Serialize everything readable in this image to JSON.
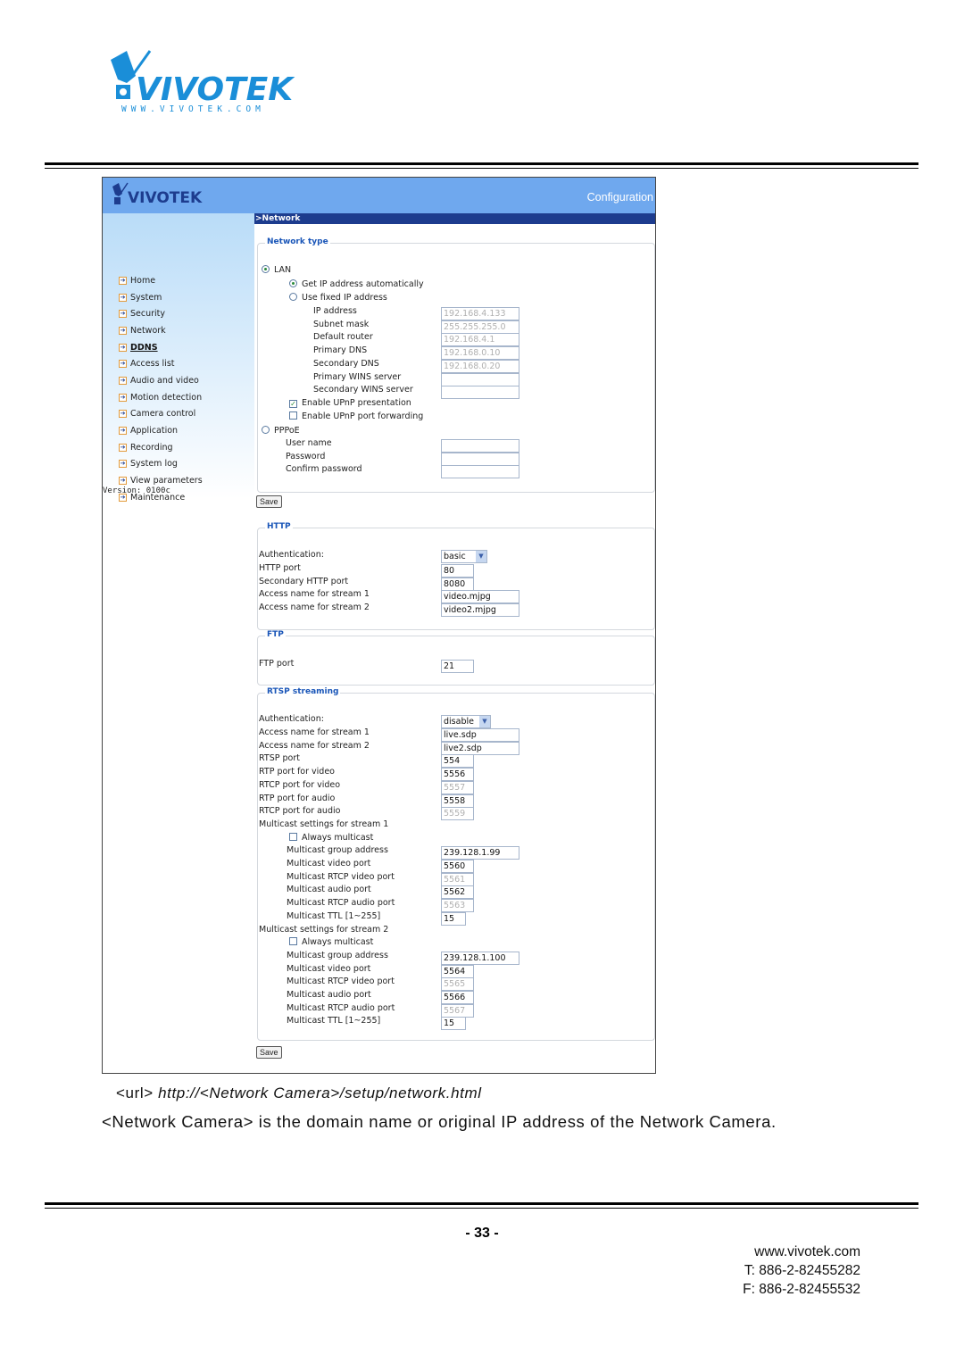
{
  "page": {
    "logo_text": "VIVOTEK",
    "logo_url_text": "WWW.VIVOTEK.COM",
    "brand_color": "#1a8ed8",
    "caption_url_prefix": "<url>",
    "caption_url": "http://<Network Camera>/setup/network.html",
    "caption_note": "<Network Camera> is the domain name or original IP address of the Network Camera.",
    "page_number": "- 33 -",
    "contact": {
      "web": "www.vivotek.com",
      "tel": "T: 886-2-82455282",
      "fax": "F: 886-2-82455532"
    }
  },
  "app": {
    "logo_text": "VIVOTEK",
    "header_title": "Configuration",
    "breadcrumb": ">Network",
    "header_color": "#6fa8ee",
    "nav_bar_color": "#1d3c8e",
    "version": "Version: 0100c",
    "sidebar": {
      "items": [
        {
          "label": "Home"
        },
        {
          "label": "System"
        },
        {
          "label": "Security"
        },
        {
          "label": "Network"
        },
        {
          "label": "DDNS",
          "active": true
        },
        {
          "label": "Access list"
        },
        {
          "label": "Audio and video"
        },
        {
          "label": "Motion detection"
        },
        {
          "label": "Camera control"
        },
        {
          "label": "Application"
        },
        {
          "label": "Recording"
        },
        {
          "label": "System log"
        },
        {
          "label": "View parameters"
        },
        {
          "label": "Maintenance"
        }
      ]
    },
    "network_type": {
      "legend": "Network type",
      "lan_label": "LAN",
      "lan_selected": true,
      "auto_ip_label": "Get IP address automatically",
      "auto_ip_selected": true,
      "fixed_ip_label": "Use fixed IP address",
      "fixed_ip_selected": false,
      "fields": [
        {
          "label": "IP address",
          "value": "192.168.4.133"
        },
        {
          "label": "Subnet mask",
          "value": "255.255.255.0"
        },
        {
          "label": "Default router",
          "value": "192.168.4.1"
        },
        {
          "label": "Primary DNS",
          "value": "192.168.0.10"
        },
        {
          "label": "Secondary DNS",
          "value": "192.168.0.20"
        },
        {
          "label": "Primary WINS server",
          "value": ""
        },
        {
          "label": "Secondary WINS server",
          "value": ""
        }
      ],
      "upnp_presentation_label": "Enable UPnP presentation",
      "upnp_presentation_checked": true,
      "upnp_forwarding_label": "Enable UPnP port forwarding",
      "upnp_forwarding_checked": false,
      "pppoe_label": "PPPoE",
      "pppoe_selected": false,
      "pppoe_fields": [
        {
          "label": "User name",
          "value": ""
        },
        {
          "label": "Password",
          "value": ""
        },
        {
          "label": "Confirm password",
          "value": ""
        }
      ]
    },
    "save_label": "Save",
    "http": {
      "legend": "HTTP",
      "auth_label": "Authentication:",
      "auth_value": "basic",
      "fields": [
        {
          "label": "HTTP port",
          "value": "80"
        },
        {
          "label": "Secondary HTTP port",
          "value": "8080"
        },
        {
          "label": "Access name for stream 1",
          "value": "video.mjpg"
        },
        {
          "label": "Access name for stream 2",
          "value": "video2.mjpg"
        }
      ]
    },
    "ftp": {
      "legend": "FTP",
      "port_label": "FTP port",
      "port_value": "21"
    },
    "rtsp": {
      "legend": "RTSP streaming",
      "auth_label": "Authentication:",
      "auth_value": "disable",
      "fields": [
        {
          "label": "Access name for stream 1",
          "value": "live.sdp"
        },
        {
          "label": "Access name for stream 2",
          "value": "live2.sdp"
        },
        {
          "label": "RTSP port",
          "value": "554"
        },
        {
          "label": "RTP port for video",
          "value": "5556"
        },
        {
          "label": "RTCP port for video",
          "value": "5557",
          "disabled": true
        },
        {
          "label": "RTP port for audio",
          "value": "5558"
        },
        {
          "label": "RTCP port for audio",
          "value": "5559",
          "disabled": true
        }
      ],
      "multicast": [
        {
          "heading": "Multicast settings for stream 1",
          "always_label": "Always multicast",
          "always_checked": false,
          "fields": [
            {
              "label": "Multicast group address",
              "value": "239.128.1.99"
            },
            {
              "label": "Multicast video port",
              "value": "5560"
            },
            {
              "label": "Multicast RTCP video port",
              "value": "5561",
              "disabled": true
            },
            {
              "label": "Multicast audio port",
              "value": "5562"
            },
            {
              "label": "Multicast RTCP audio port",
              "value": "5563",
              "disabled": true
            },
            {
              "label": "Multicast TTL [1~255]",
              "value": "15"
            }
          ]
        },
        {
          "heading": "Multicast settings for stream 2",
          "always_label": "Always multicast",
          "always_checked": false,
          "fields": [
            {
              "label": "Multicast group address",
              "value": "239.128.1.100"
            },
            {
              "label": "Multicast video port",
              "value": "5564"
            },
            {
              "label": "Multicast RTCP video port",
              "value": "5565",
              "disabled": true
            },
            {
              "label": "Multicast audio port",
              "value": "5566"
            },
            {
              "label": "Multicast RTCP audio port",
              "value": "5567",
              "disabled": true
            },
            {
              "label": "Multicast TTL [1~255]",
              "value": "15"
            }
          ]
        }
      ]
    }
  }
}
